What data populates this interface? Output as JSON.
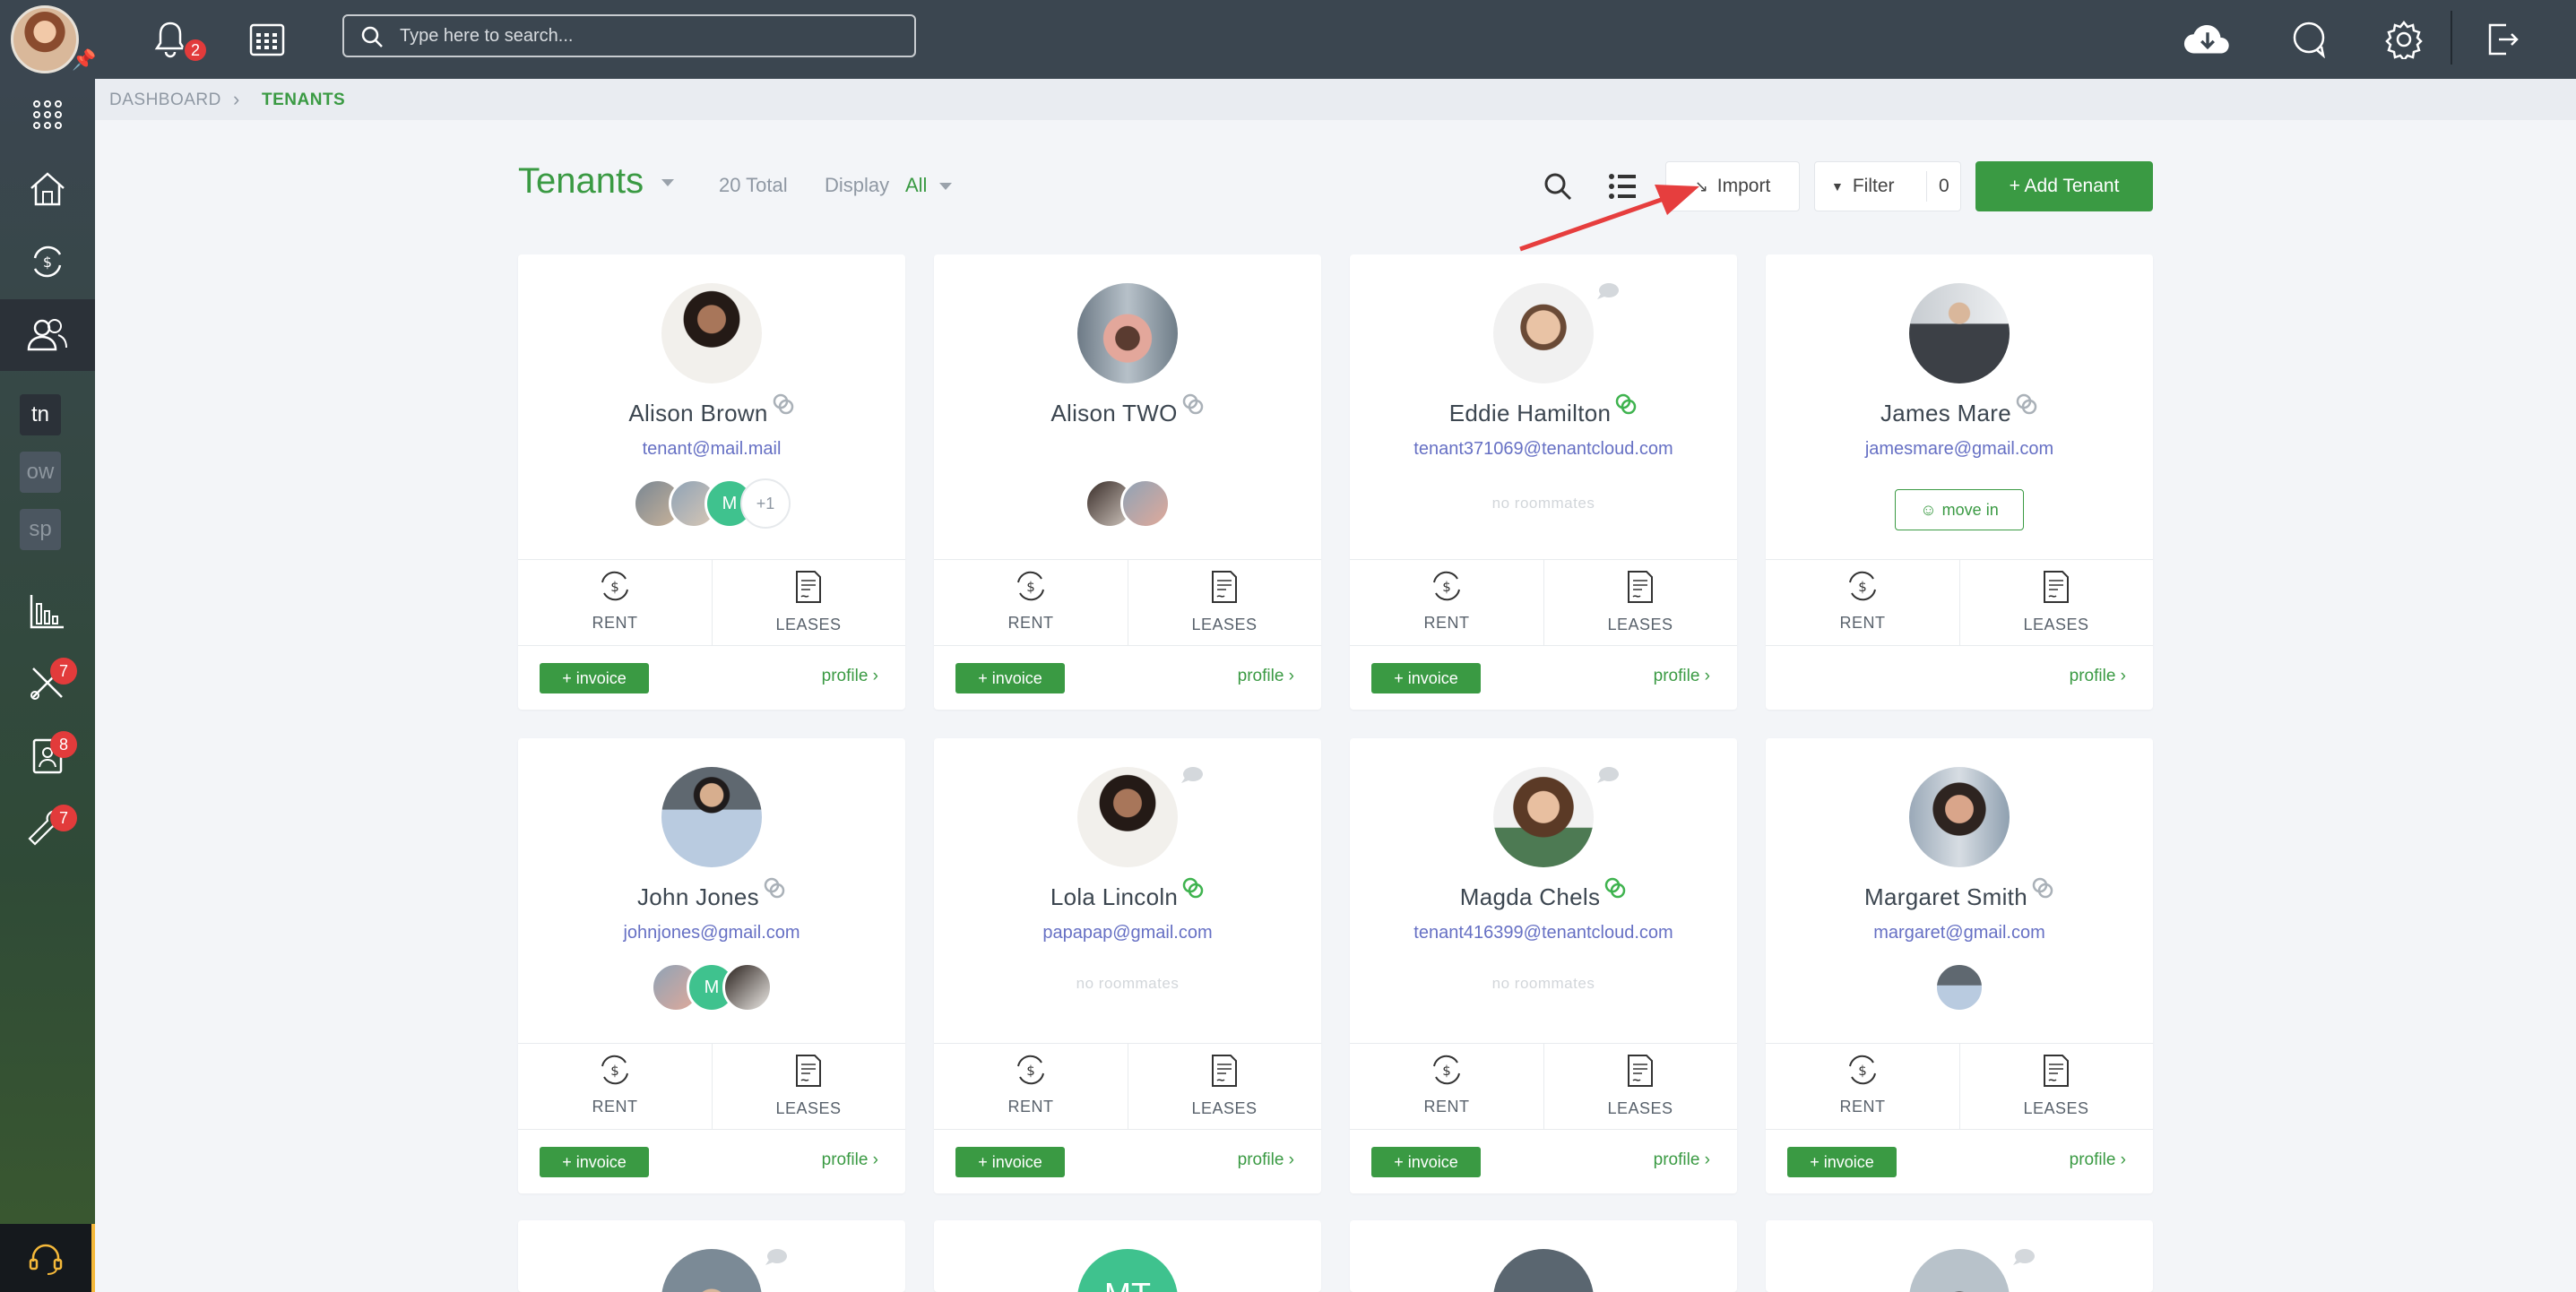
{
  "topbar": {
    "notifications_count": "2",
    "search_placeholder": "Type here to search..."
  },
  "sidebar": {
    "chips": [
      "tn",
      "ow",
      "sp"
    ],
    "badges": {
      "maintenance": "7",
      "applications": "8",
      "tools": "7"
    }
  },
  "breadcrumb": {
    "root": "DASHBOARD",
    "current": "TENANTS"
  },
  "header": {
    "title": "Tenants",
    "total": "20 Total",
    "display_label": "Display",
    "display_value": "All",
    "import_label": "Import",
    "filter_label": "Filter",
    "filter_count": "0",
    "add_label": "+ Add Tenant"
  },
  "card_labels": {
    "rent": "RENT",
    "leases": "LEASES",
    "invoice": "+ invoice",
    "profile": "profile",
    "no_roommates": "no roommates",
    "move_in": "move in"
  },
  "tenants": [
    {
      "name": "Alison Brown",
      "email": "tenant@mail.mail",
      "roommates_more": "+1",
      "roommate_initial": "M"
    },
    {
      "name": "Alison TWO",
      "email": ""
    },
    {
      "name": "Eddie Hamilton",
      "email": "tenant371069@tenantcloud.com"
    },
    {
      "name": "James Mare",
      "email": "jamesmare@gmail.com"
    },
    {
      "name": "John Jones",
      "email": "johnjones@gmail.com",
      "roommate_initial": "M"
    },
    {
      "name": "Lola Lincoln",
      "email": "papapap@gmail.com"
    },
    {
      "name": "Magda Chels",
      "email": "tenant416399@tenantcloud.com"
    },
    {
      "name": "Margaret Smith",
      "email": "margaret@gmail.com"
    }
  ],
  "partial_cards": [
    {
      "initials": "MT"
    }
  ],
  "colors": {
    "brand_green": "#3a9a43",
    "topbar": "#3b4650",
    "badge_red": "#e23b3b",
    "link_purple": "#6670c4"
  }
}
